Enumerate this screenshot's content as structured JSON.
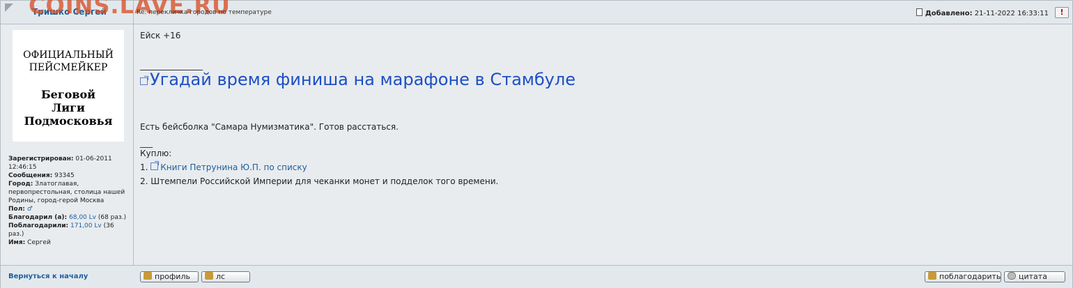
{
  "header": {
    "watermark": "COINS.LAVE.RU",
    "author": "Тришко Сергей",
    "subject": "Re: перекличка городов по температуре",
    "date_label": "Добавлено:",
    "date_value": "21-11-2022 16:33:11",
    "report_symbol": "!"
  },
  "avatar": {
    "line1": "ОФИЦИАЛЬНЫЙ",
    "line2": "ПЕЙСМЕЙКЕР",
    "line3": "Беговой",
    "line4": "Лиги",
    "line5": "Подмосковья"
  },
  "profile": {
    "registered_label": "Зарегистрирован:",
    "registered_value": "01-06-2011 12:46:15",
    "messages_label": "Сообщения:",
    "messages_value": "93345",
    "city_label": "Город:",
    "city_value": "Златоглавая, первопрестольная, столица нашей Родины, город-герой Москва",
    "gender_label": "Пол:",
    "gender_icon": "male-icon",
    "thanked_label": "Благодарил (а):",
    "thanked_amount": "68,00 Lv",
    "thanked_count": "(68 раз.)",
    "thanked_by_label": "Поблагодарили:",
    "thanked_by_amount": "171,00 Lv",
    "thanked_by_count": "(36 раз.)",
    "name_label": "Имя:",
    "name_value": "Сергей"
  },
  "post": {
    "line1": "Ейск +16",
    "separator1": "_______________",
    "title_link": "Угадай время финиша на марафоне в Стамбуле",
    "line3": "Есть бейсболка \"Самара Нумизматика\". Готов расстаться.",
    "separator2": "___",
    "line4": "Куплю:",
    "item1_prefix": "1.",
    "item1_link": "Книги Петрунина Ю.П. по списку",
    "item2": "2. Штемпели Российской Империи для чеканки монет и подделок того времени."
  },
  "footer": {
    "back_link": "Вернуться к началу",
    "profile_button": "профиль",
    "pm_button": "лс",
    "thank_button": "поблагодарить",
    "quote_button": "цитата"
  },
  "colors": {
    "link": "#1d5f9a",
    "title_link": "#1d4fc4",
    "watermark": "#d65028",
    "background": "#e8ecef"
  }
}
